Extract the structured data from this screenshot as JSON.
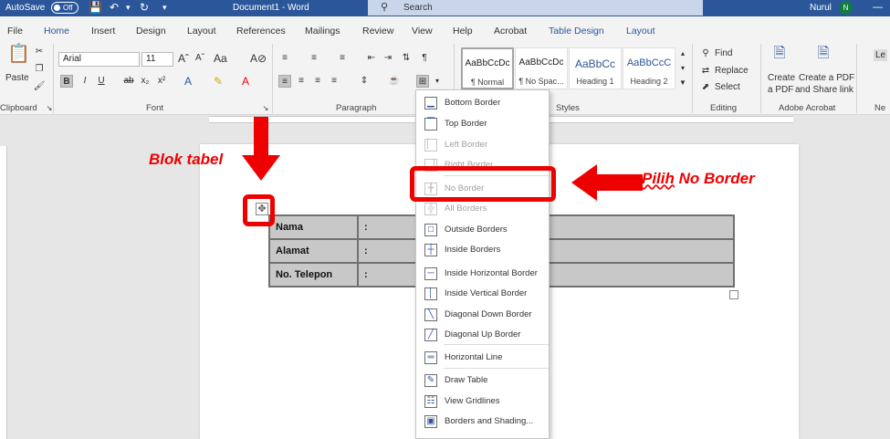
{
  "titlebar": {
    "autosave_label": "AutoSave",
    "autosave_state": "Off",
    "document_title": "Document1 - Word",
    "search_placeholder": "Search",
    "user_name": "Nurul",
    "user_initial": "N"
  },
  "tabs": [
    "File",
    "Home",
    "Insert",
    "Design",
    "Layout",
    "References",
    "Mailings",
    "Review",
    "View",
    "Help",
    "Acrobat",
    "Table Design",
    "Layout"
  ],
  "active_tab": "Home",
  "ribbon": {
    "clipboard": {
      "paste_label": "Paste",
      "group_label": "Clipboard"
    },
    "font": {
      "font_name": "Arial",
      "font_size": "11",
      "group_label": "Font"
    },
    "paragraph": {
      "group_label": "Paragraph"
    },
    "styles": {
      "group_label": "Styles",
      "tiles": [
        {
          "sample": "AaBbCcDc",
          "name": "¶ Normal"
        },
        {
          "sample": "AaBbCcDc",
          "name": "¶ No Spac..."
        },
        {
          "sample": "AaBbCc",
          "name": "Heading 1"
        },
        {
          "sample": "AaBbCcC",
          "name": "Heading 2"
        }
      ]
    },
    "editing": {
      "find": "Find",
      "replace": "Replace",
      "select": "Select",
      "group_label": "Editing"
    },
    "acrobat": {
      "create_pdf_line1": "Create",
      "create_pdf_line2": "a PDF",
      "share_line1": "Create a PDF",
      "share_line2": "and Share link",
      "group_label": "Adobe Acrobat"
    },
    "new_group": {
      "label": "Ne",
      "item": "Le"
    }
  },
  "table": {
    "rows": [
      {
        "label": "Nama",
        "value": ":"
      },
      {
        "label": "Alamat",
        "value": ":"
      },
      {
        "label": "No. Telepon",
        "value": ":"
      }
    ]
  },
  "border_menu": {
    "items": [
      {
        "label": "Bottom Border",
        "icon": "bottom-border-icon",
        "glyph": "▁"
      },
      {
        "label": "Top Border",
        "icon": "top-border-icon",
        "glyph": "▔"
      },
      {
        "label": "Left Border",
        "icon": "left-border-icon",
        "glyph": "▏"
      },
      {
        "label": "Right Border",
        "icon": "right-border-icon",
        "glyph": "▕"
      },
      {
        "label": "No Border",
        "icon": "no-border-icon",
        "glyph": "╋"
      },
      {
        "label": "All Borders",
        "icon": "all-borders-icon",
        "glyph": "╬"
      },
      {
        "label": "Outside Borders",
        "icon": "outside-borders-icon",
        "glyph": "□"
      },
      {
        "label": "Inside Borders",
        "icon": "inside-borders-icon",
        "glyph": "┼"
      },
      {
        "label": "Inside Horizontal Border",
        "icon": "inside-horizontal-border-icon",
        "glyph": "─"
      },
      {
        "label": "Inside Vertical Border",
        "icon": "inside-vertical-border-icon",
        "glyph": "│"
      },
      {
        "label": "Diagonal Down Border",
        "icon": "diagonal-down-border-icon",
        "glyph": "╲"
      },
      {
        "label": "Diagonal Up Border",
        "icon": "diagonal-up-border-icon",
        "glyph": "╱"
      },
      {
        "label": "Horizontal Line",
        "icon": "horizontal-line-icon",
        "glyph": "═"
      },
      {
        "label": "Draw Table",
        "icon": "draw-table-icon",
        "glyph": "✎"
      },
      {
        "label": "View Gridlines",
        "icon": "view-gridlines-icon",
        "glyph": "☷"
      },
      {
        "label": "Borders and Shading...",
        "icon": "borders-and-shading-icon",
        "glyph": "▣"
      }
    ]
  },
  "annotations": {
    "block_table": "Blok tabel",
    "choose_prefix": "Pilih",
    "choose_rest": " No Border"
  },
  "colors": {
    "word_blue": "#2b579a",
    "annotation_red": "#ee0000",
    "table_fill": "#c8c8c8"
  }
}
